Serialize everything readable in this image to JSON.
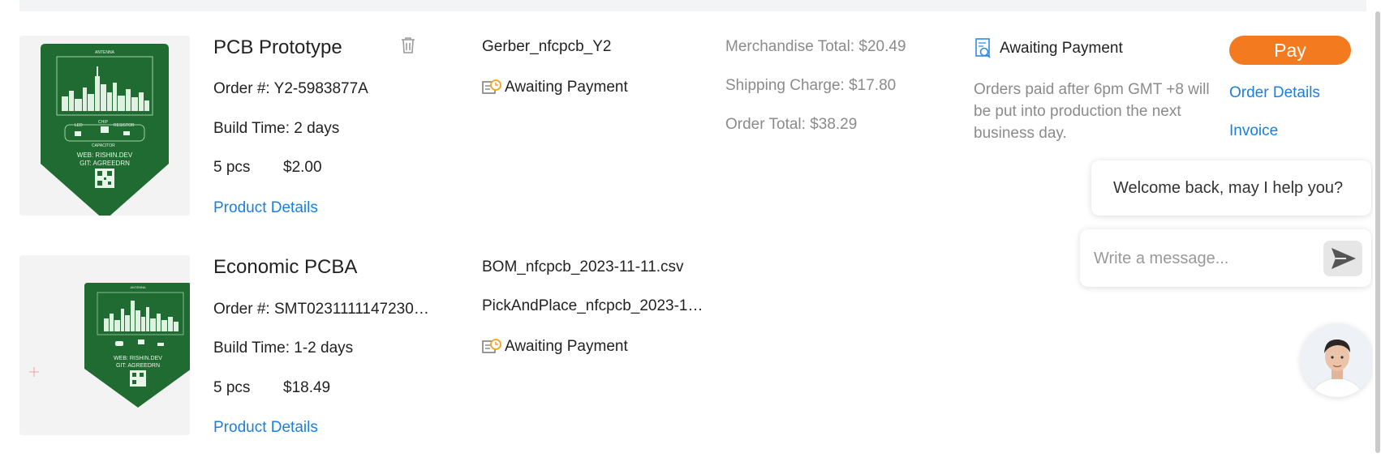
{
  "orders": [
    {
      "product": "PCB Prototype",
      "order_no_label": "Order #:",
      "order_no": "Y2-5983877A",
      "build_time_label": "Build Time:",
      "build_time": "2 days",
      "qty": "5 pcs",
      "price": "$2.00",
      "details_link": "Product Details",
      "files": [
        "Gerber_nfcpcb_Y2"
      ],
      "file_status": "Awaiting Payment",
      "merchandise_total": "Merchandise Total: $20.49",
      "shipping_charge": "Shipping Charge: $17.80",
      "order_total": "Order Total: $38.29",
      "order_status": "Awaiting Payment",
      "note": "Orders paid after 6pm GMT +8 will be put into production the next business day.",
      "pay_label": "Pay",
      "order_details_link": "Order Details",
      "invoice_link": "Invoice",
      "board_silkscreen": [
        "ANTENNA",
        "WEB: RISHIN.DEV",
        "GIT: AGREEDRN",
        "LED",
        "CHIP",
        "RESISTOR",
        "CAPACITOR"
      ]
    },
    {
      "product": "Economic PCBA",
      "order_no_label": "Order #:",
      "order_no": "SMT0231111147230…",
      "build_time_label": "Build Time:",
      "build_time": "1-2 days",
      "qty": "5 pcs",
      "price": "$18.49",
      "details_link": "Product Details",
      "files": [
        "BOM_nfcpcb_2023-11-11.csv",
        "PickAndPlace_nfcpcb_2023-1…"
      ],
      "file_status": "Awaiting Payment",
      "board_silkscreen": [
        "ANTENNA",
        "WEB: RISHIN.DEV",
        "GIT: AGREEDRN"
      ]
    }
  ],
  "chat": {
    "greeting": "Welcome back, may I help you?",
    "placeholder": "Write a message..."
  },
  "colors": {
    "accent": "#f47a20",
    "link": "#1a7fe0",
    "pcb_green": "#1f6b32"
  },
  "icons": [
    "trash-icon",
    "clock-document-icon",
    "search-document-icon",
    "send-icon",
    "agent-avatar"
  ]
}
